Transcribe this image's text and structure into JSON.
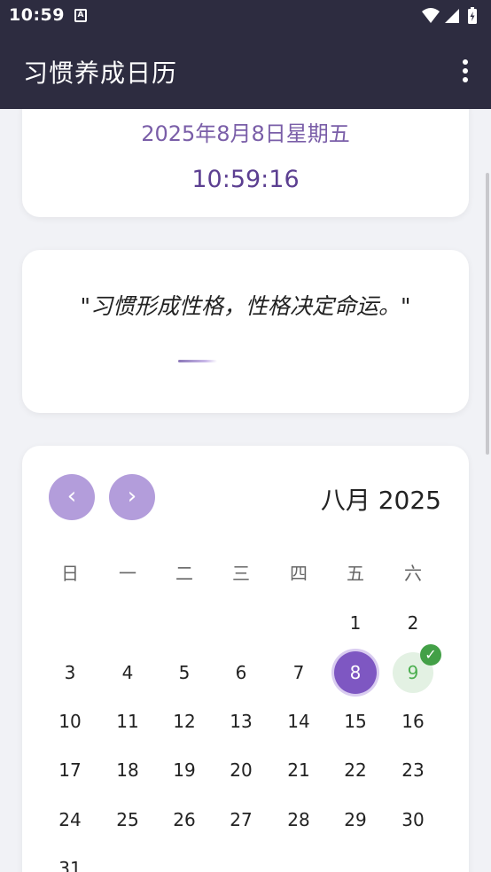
{
  "status_bar": {
    "time": "10:59",
    "notification_icon": "A"
  },
  "app_bar": {
    "title": "习惯养成日历"
  },
  "date_card": {
    "date": "2025年8月8日星期五",
    "time": "10:59:16"
  },
  "quote_card": {
    "quote": "\"习惯形成性格，性格决定命运。\""
  },
  "calendar": {
    "prev_label": "‹",
    "next_label": "›",
    "month_title": "八月 2025",
    "weekdays": [
      "日",
      "一",
      "二",
      "三",
      "四",
      "五",
      "六"
    ],
    "days": [
      "1",
      "2",
      "3",
      "4",
      "5",
      "6",
      "7",
      "8",
      "9",
      "10",
      "11",
      "12",
      "13",
      "14",
      "15",
      "16",
      "17",
      "18",
      "19",
      "20",
      "21",
      "22",
      "23",
      "24",
      "25",
      "26",
      "27",
      "28",
      "29",
      "30",
      "31"
    ],
    "first_weekday_index": 5,
    "today": "8",
    "completed": [
      "9"
    ],
    "check_mark": "✓",
    "colors": {
      "accent": "#7e57c2",
      "nav_button": "#b39ddb",
      "completed": "#4caf50"
    }
  }
}
